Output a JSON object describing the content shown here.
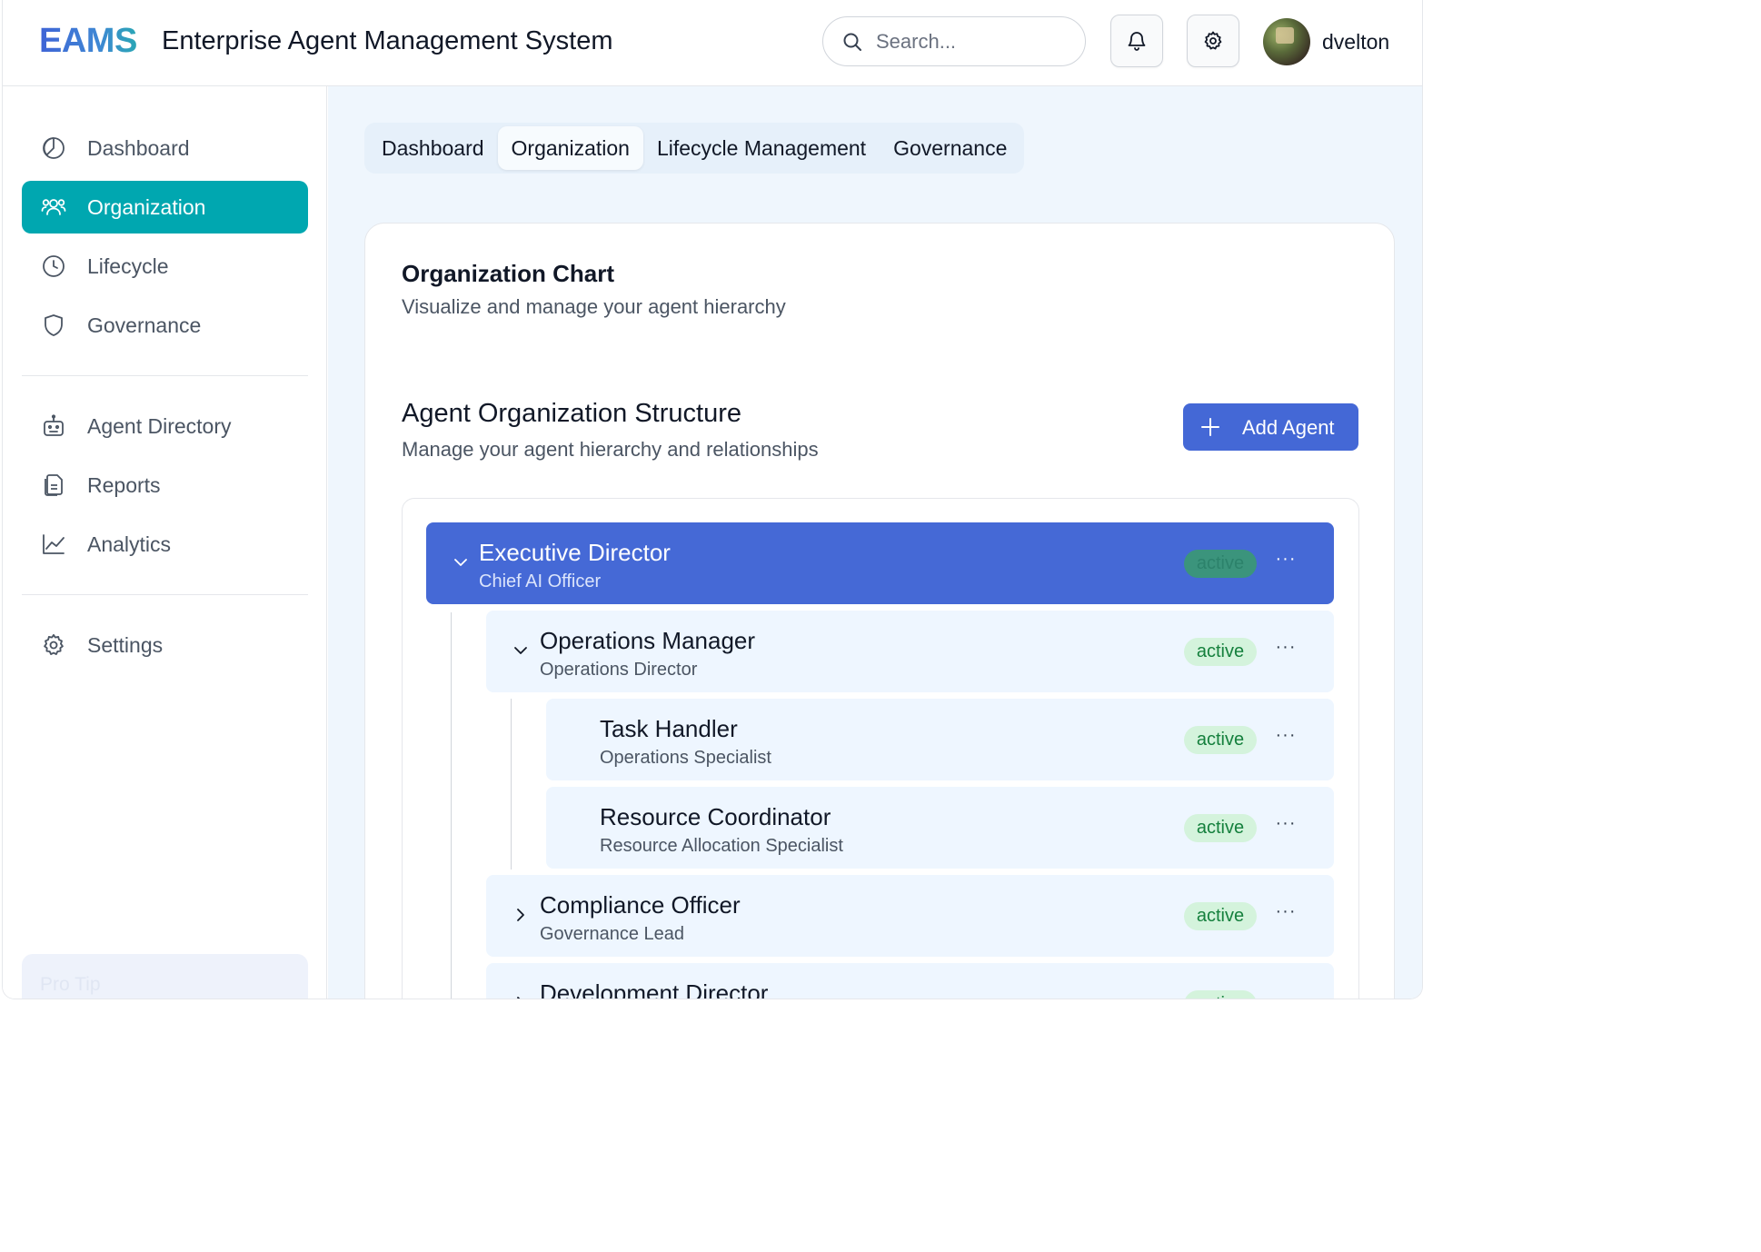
{
  "header": {
    "logo": "EAMS",
    "title": "Enterprise Agent Management System",
    "search_placeholder": "Search...",
    "username": "dvelton"
  },
  "sidebar": {
    "items": [
      {
        "label": "Dashboard",
        "icon": "pie-chart-icon"
      },
      {
        "label": "Organization",
        "icon": "users-icon",
        "active": true
      },
      {
        "label": "Lifecycle",
        "icon": "clock-icon"
      },
      {
        "label": "Governance",
        "icon": "shield-icon"
      },
      {
        "label": "Agent Directory",
        "icon": "bot-icon"
      },
      {
        "label": "Reports",
        "icon": "files-icon"
      },
      {
        "label": "Analytics",
        "icon": "line-chart-icon"
      },
      {
        "label": "Settings",
        "icon": "gear-icon"
      }
    ],
    "pro_tip": "Pro Tip"
  },
  "main": {
    "tabs": [
      {
        "label": "Dashboard"
      },
      {
        "label": "Organization",
        "active": true
      },
      {
        "label": "Lifecycle Management"
      },
      {
        "label": "Governance"
      }
    ],
    "card": {
      "title": "Organization Chart",
      "subtitle": "Visualize and manage your agent hierarchy"
    },
    "section": {
      "title": "Agent Organization Structure",
      "subtitle": "Manage your agent hierarchy and relationships",
      "add_button": "Add Agent"
    },
    "agents": [
      {
        "name": "Executive Director",
        "role": "Chief AI Officer",
        "status": "active",
        "level": 0,
        "expanded": true,
        "selected": true
      },
      {
        "name": "Operations Manager",
        "role": "Operations Director",
        "status": "active",
        "level": 1,
        "expanded": true
      },
      {
        "name": "Task Handler",
        "role": "Operations Specialist",
        "status": "active",
        "level": 2
      },
      {
        "name": "Resource Coordinator",
        "role": "Resource Allocation Specialist",
        "status": "active",
        "level": 2
      },
      {
        "name": "Compliance Officer",
        "role": "Governance Lead",
        "status": "active",
        "level": 1,
        "expanded": false
      },
      {
        "name": "Development Director",
        "role": "",
        "status": "active",
        "level": 1,
        "expanded": false
      }
    ],
    "more_label": "···"
  },
  "colors": {
    "brand": "#4468d6",
    "accent": "#00a7b0",
    "status_active": "#15803d"
  }
}
